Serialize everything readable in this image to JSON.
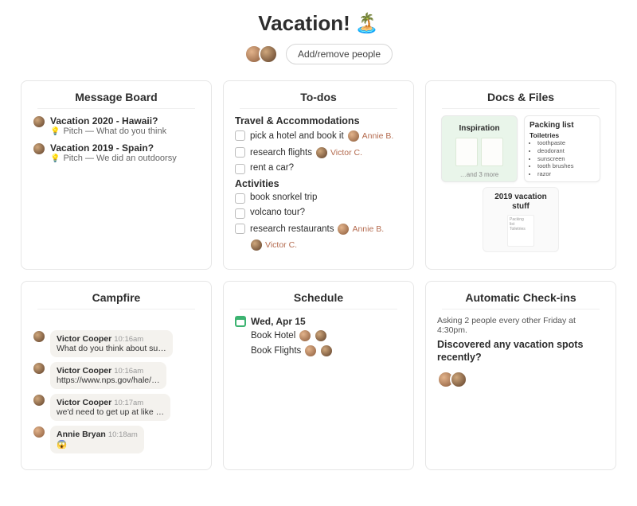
{
  "header": {
    "title": "Vacation!",
    "emoji": "🏝️",
    "add_people_label": "Add/remove people"
  },
  "cards": {
    "message_board": {
      "title": "Message Board",
      "items": [
        {
          "title": "Vacation 2020 - Hawaii?",
          "sub": "Pitch — What do you think",
          "icon": "💡"
        },
        {
          "title": "Vacation 2019 - Spain?",
          "sub": "Pitch — We did an outdoorsy",
          "icon": "💡"
        }
      ]
    },
    "todos": {
      "title": "To-dos",
      "groups": [
        {
          "name": "Travel & Accommodations",
          "items": [
            {
              "text": "pick a hotel and book it",
              "assignee": "Annie B."
            },
            {
              "text": "research flights",
              "assignee": "Victor C."
            },
            {
              "text": "rent a car?",
              "assignee": ""
            }
          ]
        },
        {
          "name": "Activities",
          "items": [
            {
              "text": "book snorkel trip",
              "assignee": ""
            },
            {
              "text": "volcano tour?",
              "assignee": ""
            },
            {
              "text": "research restaurants",
              "assignee": "Annie B.",
              "assignee2": "Victor C."
            }
          ]
        }
      ]
    },
    "docs": {
      "title": "Docs & Files",
      "inspiration_title": "Inspiration",
      "inspiration_more": "…and 3 more",
      "packing": {
        "title": "Packing list",
        "subtitle": "Toiletries",
        "items": [
          "toothpaste",
          "deodorant",
          "sunscreen",
          "tooth brushes",
          "razor"
        ]
      },
      "folder_2019": "2019 vacation stuff"
    },
    "campfire": {
      "title": "Campfire",
      "messages": [
        {
          "author": "Victor Cooper",
          "time": "10:16am",
          "body": "What do you think about su…"
        },
        {
          "author": "Victor Cooper",
          "time": "10:16am",
          "body": "https://www.nps.gov/hale/…"
        },
        {
          "author": "Victor Cooper",
          "time": "10:17am",
          "body": "we'd need to get up at like …"
        },
        {
          "author": "Annie Bryan",
          "time": "10:18am",
          "body": "😱"
        }
      ]
    },
    "schedule": {
      "title": "Schedule",
      "date": "Wed, Apr 15",
      "items": [
        "Book Hotel",
        "Book Flights"
      ]
    },
    "checkins": {
      "title": "Automatic Check-ins",
      "meta": "Asking 2 people every other Friday at 4:30pm.",
      "question": "Discovered any vacation spots recently?"
    }
  }
}
